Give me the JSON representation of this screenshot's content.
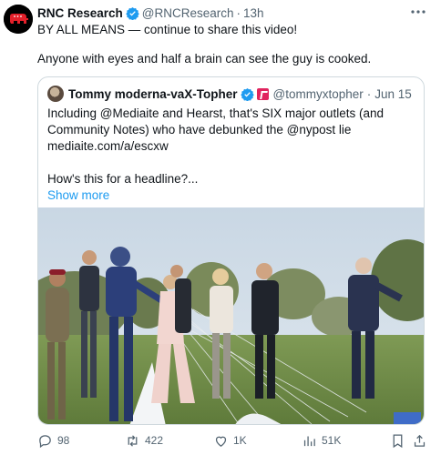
{
  "tweet": {
    "author_name": "RNC Research",
    "author_handle": "@RNCResearch",
    "separator": "·",
    "time": "13h",
    "text_line1": "BY ALL MEANS — continue to share this video!",
    "text_line2": "Anyone with eyes and half a brain can see the guy is cooked."
  },
  "quote": {
    "author_name": "Tommy moderna-vaX-Topher",
    "author_handle": "@tommyxtopher",
    "separator": "·",
    "time": "Jun 15",
    "line1": "Including @Mediaite and Hearst, that's SIX major outlets  (and",
    "line2": "Community Notes) who have debunked the @nypost lie",
    "line3": "mediaite.com/a/escxw",
    "line4": "How's this for a headline?...",
    "show_more": "Show more"
  },
  "actions": {
    "replies": "98",
    "reposts": "422",
    "likes": "1K",
    "views": "51K"
  },
  "icons": {
    "avatar": "elephant-logo-icon",
    "verified": "verified-badge-icon",
    "more": "more-options-icon",
    "reply": "reply-icon",
    "repost": "repost-icon",
    "like": "heart-icon",
    "views": "views-icon",
    "bookmark": "bookmark-icon",
    "share": "share-icon"
  },
  "colors": {
    "accent": "#1d9bf0",
    "muted": "#536471",
    "border": "#cfd9de",
    "avatar_bg": "#000000",
    "logo_red": "#e3202a"
  }
}
